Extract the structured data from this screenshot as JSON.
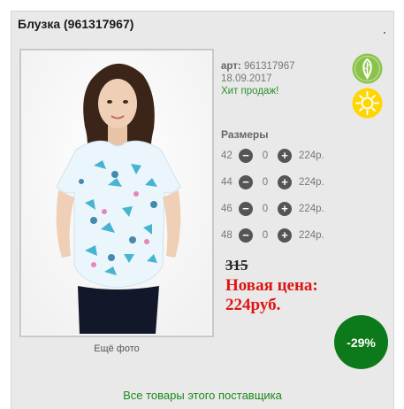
{
  "product": {
    "title": "Блузка (961317967)",
    "article_label": "арт:",
    "article_value": "961317967",
    "date": "18.09.2017",
    "badge": "Хит продаж!"
  },
  "gallery": {
    "more_photos": "Ещё фото"
  },
  "sizes": {
    "heading": "Размеры",
    "rows": [
      {
        "size": "42",
        "qty": "0",
        "price": "224р."
      },
      {
        "size": "44",
        "qty": "0",
        "price": "224р."
      },
      {
        "size": "46",
        "qty": "0",
        "price": "224р."
      },
      {
        "size": "48",
        "qty": "0",
        "price": "224р."
      }
    ]
  },
  "pricing": {
    "old_price": "315",
    "new_price_line1": "Новая цена:",
    "new_price_line2": "224руб.",
    "discount": "-29%"
  },
  "footer": {
    "supplier_link": "Все товары этого поставщика"
  },
  "colors": {
    "accent_green": "#1b8a1b",
    "discount_bg": "#0c7a1a",
    "new_price": "#e01414",
    "eco_icon": "#8bc34a",
    "sun_icon": "#ffd600"
  },
  "icons": [
    "leaf-icon",
    "sun-icon",
    "minus-icon",
    "plus-icon"
  ]
}
